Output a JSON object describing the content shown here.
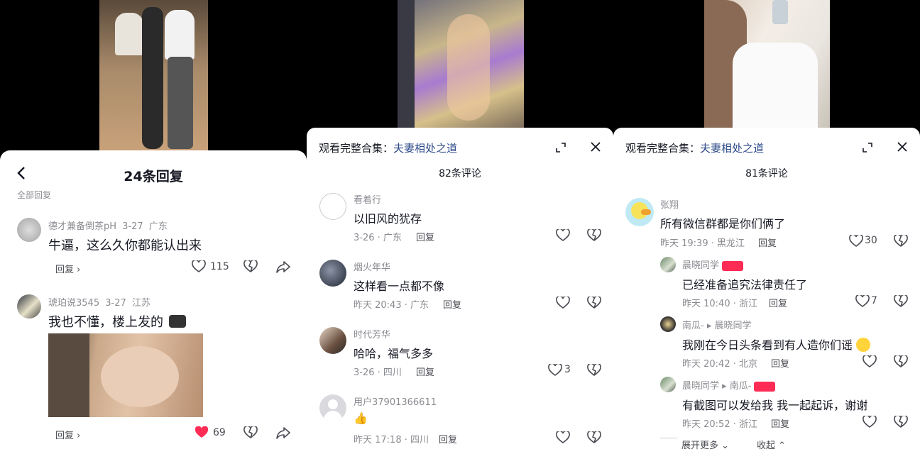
{
  "panel1": {
    "title": "24条回复",
    "subtitle": "全部回复",
    "comments": [
      {
        "user": "德才兼备倒茶pH",
        "date": "3-27",
        "location": "广东",
        "text": "牛逼，这么久你都能认出来",
        "reply": "回复 ›",
        "likes": "115"
      },
      {
        "user": "琥珀说3545",
        "date": "3-27",
        "location": "江苏",
        "text": "我也不懂，楼上发的",
        "reply": "回复 ›",
        "likes": "69"
      }
    ]
  },
  "panel2": {
    "header_prefix": "观看完整合集：",
    "header_link": "夫妻相处之道",
    "count": "82条评论",
    "comments": [
      {
        "user": "看着行",
        "text": "以旧风的犹存",
        "meta": "3-26 · 广东",
        "reply": "回复",
        "likes": ""
      },
      {
        "user": "烟火年华",
        "text": "这样看一点都不像",
        "meta": "昨天 20:43 · 广东",
        "reply": "回复",
        "likes": ""
      },
      {
        "user": "时代芳华",
        "text": "哈哈，福气多多",
        "meta": "3-26 · 四川",
        "reply": "回复",
        "likes": "3"
      },
      {
        "user": "用户37901366611",
        "text": "👍",
        "meta": "昨天 17:18 · 四川",
        "reply": "回复",
        "likes": ""
      }
    ]
  },
  "panel3": {
    "header_prefix": "观看完整合集：",
    "header_link": "夫妻相处之道",
    "count": "81条评论",
    "comments": [
      {
        "user": "张翔",
        "text": "所有微信群都是你们俩了",
        "meta": "昨天 19:39 · 黑龙江",
        "reply": "回复",
        "likes": "30"
      },
      {
        "user": "晨晓同学",
        "text": "已经准备追究法律责任了",
        "meta": "昨天 10:40 · 浙江",
        "reply": "回复",
        "likes": "7"
      },
      {
        "user": "南瓜- ▸ 晨晓同学",
        "text": "我刚在今日头条看到有人造你们谣",
        "meta": "昨天 20:42 · 北京",
        "reply": "回复",
        "likes": ""
      },
      {
        "user": "晨晓同学 ▸ 南瓜-",
        "text": "有截图可以发给我 我一起起诉，谢谢",
        "meta": "昨天 20:52 · 浙江",
        "reply": "回复",
        "likes": ""
      }
    ],
    "expand": "展开更多",
    "collapse": "收起"
  }
}
